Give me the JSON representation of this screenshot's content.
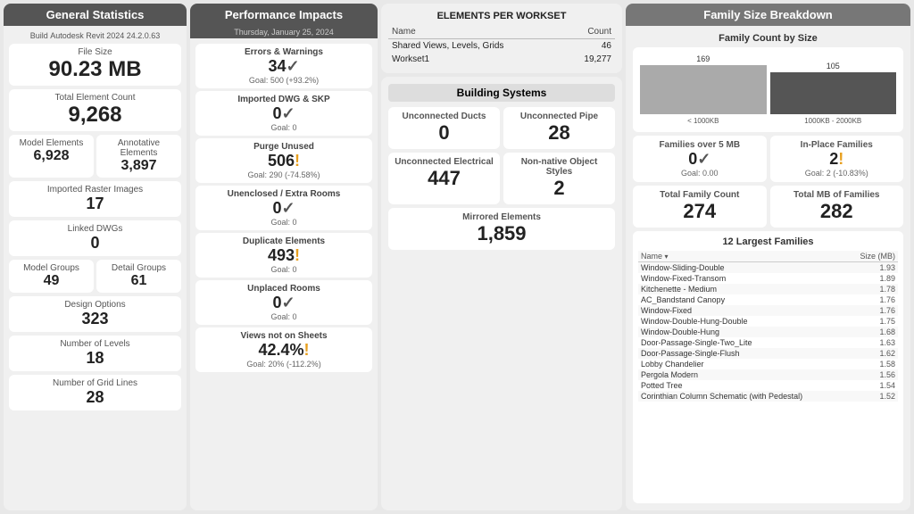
{
  "general": {
    "header": "General Statistics",
    "build_label": "Build",
    "build_value": "Autodesk Revit 2024 24.2.0.63",
    "file_size_label": "File Size",
    "file_size_value": "90.23 MB",
    "total_element_label": "Total Element Count",
    "total_element_value": "9,268",
    "model_elements_label": "Model Elements",
    "model_elements_value": "6,928",
    "annotative_elements_label": "Annotative Elements",
    "annotative_elements_value": "3,897",
    "imported_raster_label": "Imported Raster Images",
    "imported_raster_value": "17",
    "linked_dwgs_label": "Linked DWGs",
    "linked_dwgs_value": "0",
    "model_groups_label": "Model Groups",
    "model_groups_value": "49",
    "detail_groups_label": "Detail Groups",
    "detail_groups_value": "61",
    "design_options_label": "Design Options",
    "design_options_value": "323",
    "number_of_levels_label": "Number of Levels",
    "number_of_levels_value": "18",
    "number_of_grid_label": "Number of Grid Lines",
    "number_of_grid_value": "28"
  },
  "performance": {
    "header": "Performance Impacts",
    "date": "Thursday, January 25, 2024",
    "errors_label": "Errors & Warnings",
    "errors_value": "34✓",
    "errors_goal": "Goal: 500 (+93.2%)",
    "imported_label": "Imported DWG & SKP",
    "imported_value": "0✓",
    "imported_goal": "Goal: 0",
    "purge_label": "Purge Unused",
    "purge_value": "506!",
    "purge_goal": "Goal: 290 (-74.58%)",
    "unenclosed_label": "Unenclosed / Extra Rooms",
    "unenclosed_value": "0✓",
    "unenclosed_goal": "Goal: 0",
    "duplicate_label": "Duplicate Elements",
    "duplicate_value": "493!",
    "duplicate_goal": "Goal: 0",
    "unplaced_label": "Unplaced Rooms",
    "unplaced_value": "0✓",
    "unplaced_goal": "Goal: 0",
    "views_label": "Views not on Sheets",
    "views_value": "42.4%!",
    "views_goal": "Goal: 20% (-112.2%)"
  },
  "workset": {
    "title": "ELEMENTS PER WORKSET",
    "col_name": "Name",
    "col_count": "Count",
    "rows": [
      {
        "name": "Shared Views, Levels, Grids",
        "count": "46"
      },
      {
        "name": "Workset1",
        "count": "19,277"
      }
    ]
  },
  "building_systems": {
    "title": "Building Systems",
    "unconnected_ducts_label": "Unconnected Ducts",
    "unconnected_ducts_value": "0",
    "unconnected_pipe_label": "Unconnected Pipe",
    "unconnected_pipe_value": "28",
    "unconnected_electrical_label": "Unconnected Electrical",
    "unconnected_electrical_value": "447",
    "non_native_label": "Non-native Object Styles",
    "non_native_value": "2",
    "mirrored_label": "Mirrored Elements",
    "mirrored_value": "1,859"
  },
  "family_size": {
    "header": "Family Size Breakdown",
    "chart_title": "Family Count by Size",
    "bar1_label": "< 1000KB",
    "bar1_value": 169,
    "bar1_display": "169",
    "bar2_label": "1000KB - 2000KB",
    "bar2_value": 105,
    "bar2_display": "105",
    "families_over_5mb_label": "Families over 5 MB",
    "families_over_5mb_value": "0✓",
    "families_over_5mb_goal": "Goal: 0.00",
    "in_place_label": "In-Place Families",
    "in_place_value": "2!",
    "in_place_goal": "Goal: 2 (-10.83%)",
    "total_family_label": "Total Family Count",
    "total_family_value": "274",
    "total_mb_label": "Total MB of Families",
    "total_mb_value": "282",
    "largest_title": "12 Largest Families",
    "largest_col_name": "Name",
    "largest_col_size": "Size (MB)",
    "largest_rows": [
      {
        "name": "Window-Sliding-Double",
        "size": "1.93"
      },
      {
        "name": "Window-Fixed-Transom",
        "size": "1.89"
      },
      {
        "name": "Kitchenette - Medium",
        "size": "1.78"
      },
      {
        "name": "AC_Bandstand Canopy",
        "size": "1.76"
      },
      {
        "name": "Window-Fixed",
        "size": "1.76"
      },
      {
        "name": "Window-Double-Hung-Double",
        "size": "1.75"
      },
      {
        "name": "Window-Double-Hung",
        "size": "1.68"
      },
      {
        "name": "Door-Passage-Single-Two_Lite",
        "size": "1.63"
      },
      {
        "name": "Door-Passage-Single-Flush",
        "size": "1.62"
      },
      {
        "name": "Lobby Chandelier",
        "size": "1.58"
      },
      {
        "name": "Pergola Modern",
        "size": "1.56"
      },
      {
        "name": "Potted Tree",
        "size": "1.54"
      },
      {
        "name": "Corinthian Column Schematic (with Pedestal)",
        "size": "1.52"
      }
    ]
  }
}
